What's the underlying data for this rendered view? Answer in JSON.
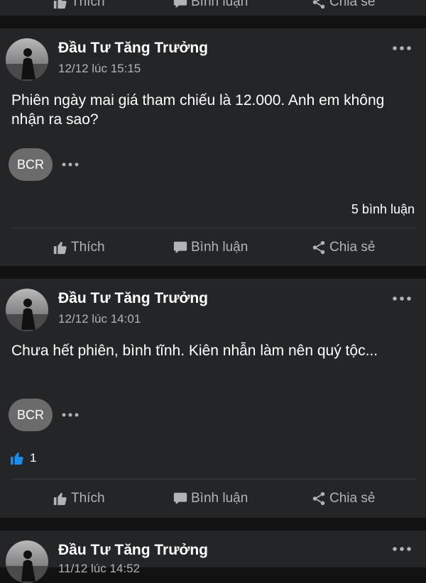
{
  "top_bar": {
    "like_label": "Thích",
    "comment_label": "Bình luận",
    "share_label": "Chia sẻ"
  },
  "posts": [
    {
      "author": "Đầu Tư Tăng Trưởng",
      "time": "12/12 lúc 15:15",
      "text": "Phiên ngày mai giá tham chiếu là 12.000. Anh em không nhận ra sao?",
      "badge": "BCR",
      "comment_count": "5 bình luận",
      "like_label": "Thích",
      "comment_label": "Bình luận",
      "share_label": "Chia sẻ"
    },
    {
      "author": "Đầu Tư Tăng Trưởng",
      "time": "12/12 lúc 14:01",
      "text": "Chưa hết phiên, bình tĩnh. Kiên nhẫn làm nên quý tộc...",
      "badge": "BCR",
      "reaction_count": "1",
      "like_label": "Thích",
      "comment_label": "Bình luận",
      "share_label": "Chia sẻ"
    },
    {
      "author": "Đầu Tư Tăng Trưởng",
      "time": "11/12 lúc 14:52"
    }
  ],
  "colors": {
    "background": "#121212",
    "card": "#242526",
    "secondary_text": "#b0b3b8",
    "like_blue": "#1b8cf0"
  },
  "icons": [
    "thumbs-up-icon",
    "comment-icon",
    "share-icon",
    "more-icon"
  ]
}
